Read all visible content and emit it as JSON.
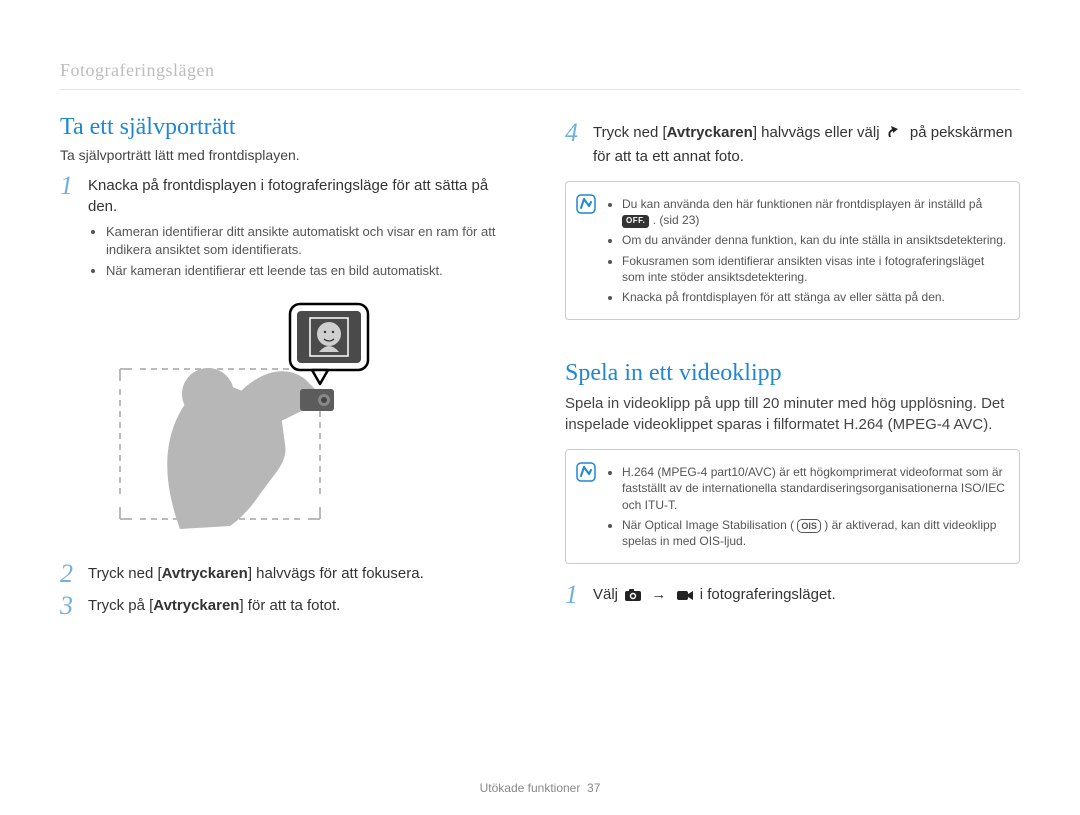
{
  "breadcrumb": "Fotograferingslägen",
  "left": {
    "title": "Ta ett självporträtt",
    "intro": "Ta självporträtt lätt med frontdisplayen.",
    "step1_num": "1",
    "step1_text_a": "Knacka på frontdisplayen i fotograferingsläge för att sätta på den.",
    "sub1_a": "Kameran identifierar ditt ansikte automatiskt och visar en ram för att indikera ansiktet som identifierats.",
    "sub1_b": "När kameran identifierar ett leende tas en bild automatiskt.",
    "step2_num": "2",
    "step2_text_a": "Tryck ned [",
    "step2_bold": "Avtryckaren",
    "step2_text_b": "] halvvägs för att fokusera.",
    "step3_num": "3",
    "step3_text_a": "Tryck på [",
    "step3_bold": "Avtryckaren",
    "step3_text_b": "] för att ta fotot."
  },
  "right": {
    "step4_num": "4",
    "step4_text_a": "Tryck ned [",
    "step4_bold": "Avtryckaren",
    "step4_text_b": "] halvvägs eller välj ",
    "step4_text_c": " på pekskärmen för att ta ett annat foto.",
    "note1_a_pre": "Du kan använda den här funktionen när frontdisplayen är inställd på ",
    "note1_a_post": ". (sid 23)",
    "note1_b": "Om du använder denna funktion, kan du inte ställa in ansiktsdetektering.",
    "note1_c": "Fokusramen som identifierar ansikten visas inte i fotograferingsläget som inte stöder ansiktsdetektering.",
    "note1_d": "Knacka på frontdisplayen för att stänga av eller sätta på den.",
    "title2": "Spela in ett videoklipp",
    "intro2": "Spela in videoklipp på upp till 20 minuter med hög upplösning. Det inspelade videoklippet sparas i filformatet H.264 (MPEG-4 AVC).",
    "note2_a": "H.264 (MPEG-4 part10/AVC) är ett högkomprimerat videoformat som är fastställt av de internationella standardiseringsorganisationerna ISO/IEC och ITU-T.",
    "note2_b_pre": "När Optical Image Stabilisation (",
    "note2_b_post": ") är aktiverad, kan ditt videoklipp spelas in med OIS-ljud.",
    "vstep1_num": "1",
    "vstep1_text_a": "Välj ",
    "vstep1_text_b": " i fotograferingsläget."
  },
  "chip_off": "OFF.",
  "chip_ois": "OIS",
  "footer_text": "Utökade funktioner",
  "footer_page": "37"
}
